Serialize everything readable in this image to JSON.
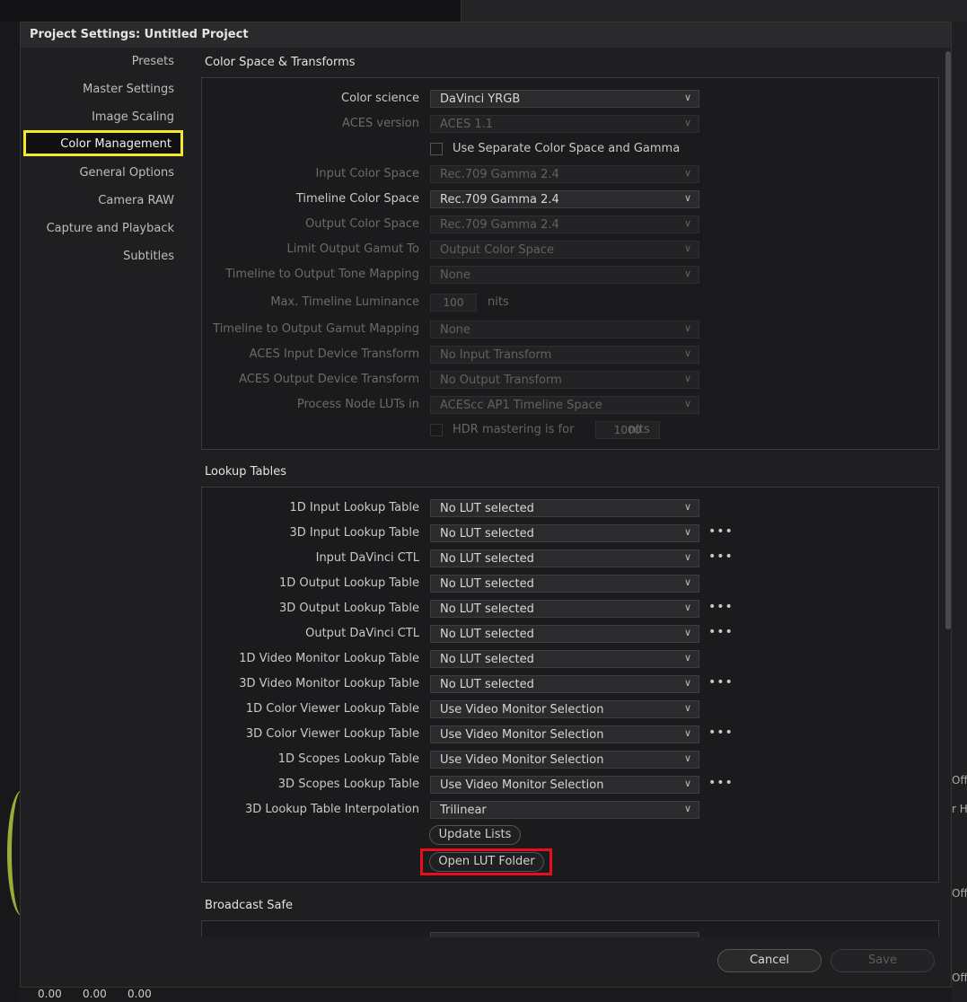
{
  "dialog": {
    "title": "Project Settings:  Untitled Project"
  },
  "nav": {
    "items": [
      "Presets",
      "Master Settings",
      "Image Scaling",
      "Color Management",
      "General Options",
      "Camera RAW",
      "Capture and Playback",
      "Subtitles"
    ],
    "active": "Color Management"
  },
  "color_space": {
    "title": "Color Space & Transforms",
    "color_science": {
      "label": "Color science",
      "value": "DaVinci YRGB"
    },
    "aces_version": {
      "label": "ACES version",
      "value": "ACES 1.1"
    },
    "separate_checkbox": {
      "label": "Use Separate Color Space and Gamma",
      "checked": false
    },
    "input_cs": {
      "label": "Input Color Space",
      "value": "Rec.709 Gamma 2.4"
    },
    "timeline_cs": {
      "label": "Timeline Color Space",
      "value": "Rec.709 Gamma 2.4"
    },
    "output_cs": {
      "label": "Output Color Space",
      "value": "Rec.709 Gamma 2.4"
    },
    "limit_gamut": {
      "label": "Limit Output Gamut To",
      "value": "Output Color Space"
    },
    "tone_mapping": {
      "label": "Timeline to Output Tone Mapping",
      "value": "None"
    },
    "max_lum": {
      "label": "Max. Timeline Luminance",
      "value": "100",
      "unit": "nits"
    },
    "gamut_mapping": {
      "label": "Timeline to Output Gamut Mapping",
      "value": "None"
    },
    "aces_idt": {
      "label": "ACES Input Device Transform",
      "value": "No Input Transform"
    },
    "aces_odt": {
      "label": "ACES Output Device Transform",
      "value": "No Output Transform"
    },
    "process_luts": {
      "label": "Process Node LUTs in",
      "value": "ACEScc AP1 Timeline Space"
    },
    "hdr": {
      "label": "HDR mastering is for",
      "value": "1000",
      "unit": "nits",
      "checked": false
    }
  },
  "luts": {
    "title": "Lookup Tables",
    "rows": [
      {
        "label": "1D Input Lookup Table",
        "value": "No LUT selected",
        "more": false
      },
      {
        "label": "3D Input Lookup Table",
        "value": "No LUT selected",
        "more": true
      },
      {
        "label": "Input DaVinci CTL",
        "value": "No LUT selected",
        "more": true
      },
      {
        "label": "1D Output Lookup Table",
        "value": "No LUT selected",
        "more": false
      },
      {
        "label": "3D Output Lookup Table",
        "value": "No LUT selected",
        "more": true
      },
      {
        "label": "Output DaVinci CTL",
        "value": "No LUT selected",
        "more": true
      },
      {
        "label": "1D Video Monitor Lookup Table",
        "value": "No LUT selected",
        "more": false
      },
      {
        "label": "3D Video Monitor Lookup Table",
        "value": "No LUT selected",
        "more": true
      },
      {
        "label": "1D Color Viewer Lookup Table",
        "value": "Use Video Monitor Selection",
        "more": false
      },
      {
        "label": "3D Color Viewer Lookup Table",
        "value": "Use Video Monitor Selection",
        "more": true
      },
      {
        "label": "1D Scopes Lookup Table",
        "value": "Use Video Monitor Selection",
        "more": false
      },
      {
        "label": "3D Scopes Lookup Table",
        "value": "Use Video Monitor Selection",
        "more": true
      },
      {
        "label": "3D Lookup Table Interpolation",
        "value": "Trilinear",
        "more": false
      }
    ],
    "more_glyph": "•••",
    "update_button": "Update Lists",
    "open_folder_button": "Open LUT Folder"
  },
  "broadcast": {
    "title": "Broadcast Safe"
  },
  "footer": {
    "cancel": "Cancel",
    "save": "Save"
  },
  "background": {
    "right_text": [
      "Offs",
      "r H",
      "Offs",
      "Offs"
    ],
    "bottom_numbers": [
      "0.00",
      "0.00",
      "0.00"
    ]
  },
  "colors": {
    "highlight": "#f4e828",
    "callout": "#e5101b"
  },
  "icons": {
    "dropdown": "chevron-down-icon",
    "more": "more-horizontal-icon"
  }
}
